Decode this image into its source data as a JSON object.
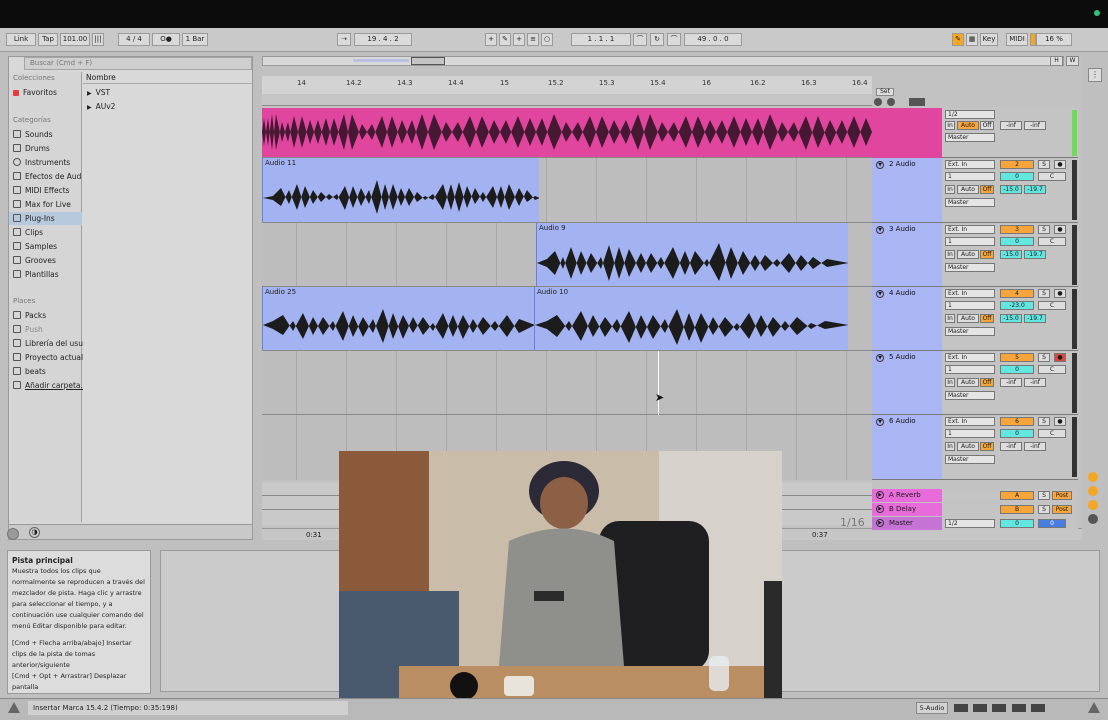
{
  "topbar": {
    "link": "Link",
    "tap": "Tap",
    "tempo": "101.00",
    "time_sig": "4 / 4",
    "metro": "O●",
    "quant": "1 Bar",
    "position": "19 . 4 . 2",
    "loop_start": "1 . 1 . 1",
    "loop_len": "49 . 0 . 0",
    "key": "Key",
    "midi": "MIDI",
    "cpu": "16 %"
  },
  "browser": {
    "search_placeholder": "Buscar (Cmd + F)",
    "collections_header": "Colecciones",
    "favorites": "Favoritos",
    "categories_header": "Categorías",
    "categories": [
      "Sounds",
      "Drums",
      "Instruments",
      "Efectos de Aud",
      "MIDI Effects",
      "Max for Live",
      "Plug-Ins",
      "Clips",
      "Samples",
      "Grooves",
      "Plantillas"
    ],
    "places_header": "Places",
    "places": [
      "Packs",
      "Push",
      "Librería del usu",
      "Proyecto actual",
      "beats",
      "Añadir carpeta..."
    ],
    "name_header": "Nombre",
    "items": [
      "VST",
      "AUv2"
    ]
  },
  "info": {
    "title": "Pista principal",
    "body": "Muestra todos los clips que normalmente se reproducen a través del mezclador de pista. Haga clic y arrastre para seleccionar el tiempo, y a continuación use cualquier comando del menú Editar disponible para editar.",
    "hint1": "[Cmd + Flecha arriba/abajo] Insertar clips de la pista de tomas anterior/siguiente",
    "hint2": "[Cmd + Opt + Arrastrar] Desplazar pantalla"
  },
  "ruler": [
    "14",
    "14.2",
    "14.3",
    "14.4",
    "15",
    "15.2",
    "15.3",
    "15.4",
    "16",
    "16.2",
    "16.3",
    "16.4"
  ],
  "set_label": "Set",
  "clips": [
    {
      "name": "Audio 11"
    },
    {
      "name": "Audio 9"
    },
    {
      "name": "Audio 25"
    },
    {
      "name": "Audio 10"
    }
  ],
  "tracks": [
    {
      "name": "2 Audio",
      "num": "2",
      "input": "Ext. In",
      "channel": "1",
      "vol": "0",
      "pan": "C",
      "l": "-15.0",
      "r": "-19.7",
      "out": "Master"
    },
    {
      "name": "3 Audio",
      "num": "3",
      "input": "Ext. In",
      "channel": "1",
      "vol": "0",
      "pan": "C",
      "l": "-15.0",
      "r": "-19.7",
      "out": "Master"
    },
    {
      "name": "4 Audio",
      "num": "4",
      "input": "Ext. In",
      "channel": "1",
      "vol": "-23.0",
      "pan": "C",
      "l": "-15.0",
      "r": "-19.7",
      "out": "Master"
    },
    {
      "name": "5 Audio",
      "num": "5",
      "input": "Ext. In",
      "channel": "1",
      "vol": "0",
      "pan": "C",
      "l": "-inf",
      "r": "-inf",
      "out": "Master"
    },
    {
      "name": "6 Audio",
      "num": "6",
      "input": "Ext. In",
      "channel": "1",
      "vol": "0",
      "pan": "C",
      "l": "-inf",
      "r": "-inf",
      "out": "Master"
    }
  ],
  "top_track": {
    "in": "In",
    "auto": "Auto",
    "off": "Off",
    "l": "-inf",
    "r": "-inf",
    "out": "Master",
    "sel": "1/2"
  },
  "returns": [
    {
      "name": "A Reverb",
      "letter": "A",
      "solo": "S",
      "post": "Post"
    },
    {
      "name": "B Delay",
      "letter": "B",
      "solo": "S",
      "post": "Post"
    }
  ],
  "master": {
    "name": "Master",
    "sel": "1/2",
    "vol": "0",
    "pan": "0"
  },
  "labels": {
    "in": "In",
    "auto": "Auto",
    "off": "Off",
    "solo": "S",
    "pan_c": "C"
  },
  "quantize_label": "1/16",
  "time_markers": [
    "0:31",
    "0:37"
  ],
  "status": {
    "text": "Insertar Marca 15.4.2 (Tiempo: 0:35:198)",
    "track": "5-Audio"
  },
  "colors": {
    "clip_blue": "#a3b2f0",
    "clip_pink": "#e1469f",
    "return_pink": "#e76cd9",
    "accent_orange": "#f6a53a",
    "accent_cyan": "#62e6e0"
  }
}
